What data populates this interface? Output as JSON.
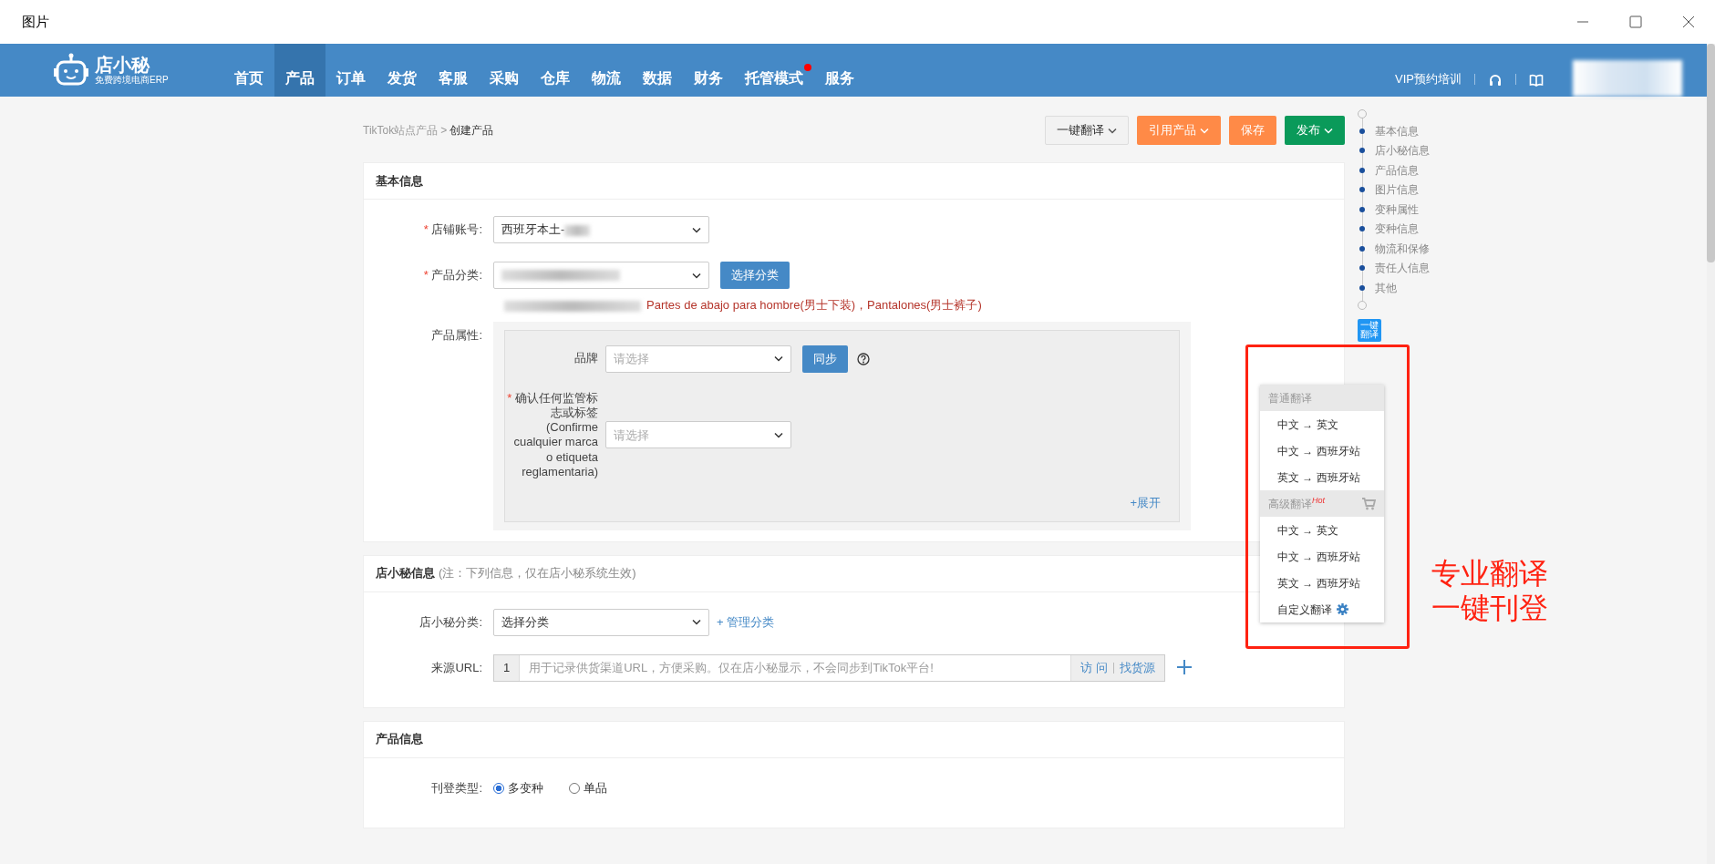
{
  "window": {
    "title": "图片"
  },
  "app": {
    "logo": {
      "name": "店小秘",
      "tagline": "免费跨境电商ERP"
    },
    "nav": [
      {
        "label": "首页",
        "selected": false,
        "notify": false
      },
      {
        "label": "产品",
        "selected": true,
        "notify": false
      },
      {
        "label": "订单",
        "selected": false,
        "notify": false
      },
      {
        "label": "发货",
        "selected": false,
        "notify": false
      },
      {
        "label": "客服",
        "selected": false,
        "notify": false
      },
      {
        "label": "采购",
        "selected": false,
        "notify": false
      },
      {
        "label": "仓库",
        "selected": false,
        "notify": false
      },
      {
        "label": "物流",
        "selected": false,
        "notify": false
      },
      {
        "label": "数据",
        "selected": false,
        "notify": false
      },
      {
        "label": "财务",
        "selected": false,
        "notify": false
      },
      {
        "label": "托管模式",
        "selected": false,
        "notify": true
      },
      {
        "label": "服务",
        "selected": false,
        "notify": false
      }
    ],
    "vip_link": "VIP预约培训"
  },
  "breadcrumb": {
    "items": [
      "TikTok站点产品",
      "创建产品"
    ],
    "separator": ">"
  },
  "actions": [
    {
      "label": "一键翻译",
      "kind": "default",
      "caret": true
    },
    {
      "label": "引用产品",
      "kind": "orange",
      "caret": true
    },
    {
      "label": "保存",
      "kind": "orange",
      "caret": false
    },
    {
      "label": "发布",
      "kind": "green",
      "caret": true
    }
  ],
  "basic_info": {
    "title": "基本信息",
    "shop": {
      "label": "店铺账号:",
      "mark": "*",
      "value": "西班牙本土-"
    },
    "category": {
      "label": "产品分类:",
      "mark": "*",
      "button": "选择分类",
      "path": "Partes de abajo para hombre(男士下装)，Pantalones(男士裤子)"
    },
    "attributes": {
      "label": "产品属性:",
      "fields": [
        {
          "label": "品牌",
          "placeholder": "请选择",
          "button": "同步",
          "help": true
        },
        {
          "label": "确认任何监管标志或标签(Confirme cualquier marca o etiqueta reglamentaria)",
          "mark": "*",
          "placeholder": "请选择"
        }
      ],
      "expand": "+展开"
    }
  },
  "dxm_info": {
    "title": "店小秘信息",
    "note": "(注：下列信息，仅在店小秘系统生效)",
    "category": {
      "label": "店小秘分类:",
      "value": "选择分类",
      "link": "+ 管理分类"
    },
    "source_url": {
      "label": "来源URL:",
      "index": "1",
      "placeholder": "用于记录供货渠道URL，方便采购。仅在店小秘显示，不会同步到TikTok平台!",
      "visit": "访 问",
      "find": "找货源"
    }
  },
  "product_info": {
    "title": "产品信息",
    "listing_type": {
      "label": "刊登类型:",
      "options": [
        {
          "label": "多变种",
          "selected": true
        },
        {
          "label": "单品",
          "selected": false
        }
      ]
    }
  },
  "side_nav": {
    "items": [
      "基本信息",
      "店小秘信息",
      "产品信息",
      "图片信息",
      "变种属性",
      "变种信息",
      "物流和保修",
      "责任人信息",
      "其他"
    ],
    "translate_button": "一键翻译"
  },
  "translate_menu": {
    "groups": [
      {
        "header": "普通翻译",
        "items": [
          {
            "label": "中文 → 英文"
          },
          {
            "label": "中文 → 西班牙站"
          },
          {
            "label": "英文 → 西班牙站"
          }
        ]
      },
      {
        "header": "高级翻译",
        "hot": "Hot",
        "cart": true,
        "items": [
          {
            "label": "中文 → 英文"
          },
          {
            "label": "中文 → 西班牙站"
          },
          {
            "label": "英文 → 西班牙站"
          },
          {
            "label": "自定义翻译",
            "gear": true
          }
        ]
      }
    ]
  },
  "annotation": [
    "专业翻译",
    "一键刊登"
  ]
}
